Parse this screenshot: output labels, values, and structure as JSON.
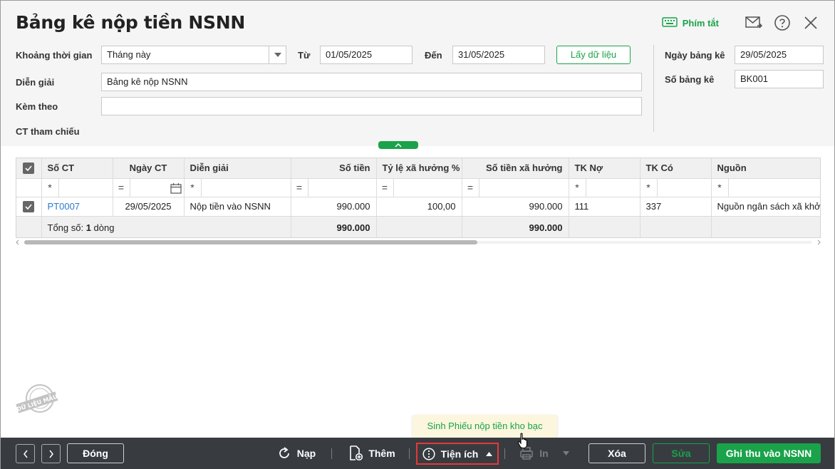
{
  "window": {
    "title": "Bảng kê nộp tiền NSNN",
    "shortcut_label": "Phím tắt",
    "icons": [
      "keyboard-icon",
      "mail-icon",
      "help-icon",
      "close-icon"
    ]
  },
  "form": {
    "period_label": "Khoảng thời gian",
    "period_value": "Tháng này",
    "from_label": "Từ",
    "from_value": "01/05/2025",
    "to_label": "Đến",
    "to_value": "31/05/2025",
    "fetch_label": "Lấy dữ liệu",
    "desc_label": "Diễn giải",
    "desc_value": "Bảng kê nộp NSNN",
    "attach_label": "Kèm theo",
    "attach_value": "",
    "ref_label": "CT tham chiếu",
    "date_label": "Ngày bảng kê",
    "date_value": "29/05/2025",
    "number_label": "Số bảng kê",
    "number_value": "BK001"
  },
  "grid": {
    "columns": [
      "Số CT",
      "Ngày CT",
      "Diễn giải",
      "Số tiền",
      "Tỷ lệ xã hưởng %",
      "Số tiền xã hưởng",
      "TK Nợ",
      "TK Có",
      "Nguồn"
    ],
    "filter_ops": [
      "*",
      "=",
      "*",
      "=",
      "=",
      "=",
      "*",
      "*",
      "*"
    ],
    "rows": [
      {
        "so_ct": "PT0007",
        "ngay_ct": "29/05/2025",
        "dien_giai": "Nộp tiền vào NSNN",
        "so_tien": "990.000",
        "ty_le": "100,00",
        "so_tien_xa": "990.000",
        "tk_no": "111",
        "tk_co": "337",
        "nguon": "Nguồn ngân sách xã khởi"
      }
    ],
    "total_label_prefix": "Tổng số: ",
    "total_count": "1",
    "total_label_suffix": " dòng",
    "total_so_tien": "990.000",
    "total_so_tien_xa": "990.000"
  },
  "stamp_text": "DỮ LIỆU MẪU",
  "tooltip": "Sinh Phiếu nộp tiền kho bạc",
  "footer": {
    "close": "Đóng",
    "reload": "Nạp",
    "add": "Thêm",
    "utilities": "Tiện ích",
    "print": "In",
    "delete": "Xóa",
    "edit": "Sửa",
    "record": "Ghi thu vào NSNN"
  },
  "colors": {
    "accent": "#1aa34a",
    "footer_bg": "#383c41",
    "link": "#2b7bd0",
    "highlight": "#e53935"
  }
}
